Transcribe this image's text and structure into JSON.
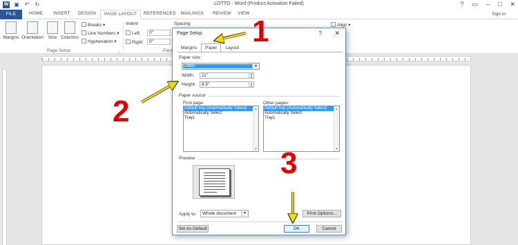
{
  "window": {
    "title": "LOTTO - Word (Product Activation Failed)",
    "quick_access": [
      "word-icon",
      "save-icon",
      "undo-icon",
      "redo-icon"
    ],
    "controls": [
      "?",
      "▭",
      "–",
      "□",
      "✕"
    ]
  },
  "ribbon": {
    "tabs": [
      {
        "label": "FILE"
      },
      {
        "label": "HOME"
      },
      {
        "label": "INSERT"
      },
      {
        "label": "DESIGN"
      },
      {
        "label": "PAGE LAYOUT"
      },
      {
        "label": "REFERENCES"
      },
      {
        "label": "MAILINGS"
      },
      {
        "label": "REVIEW"
      },
      {
        "label": "VIEW"
      }
    ],
    "active_tab": "PAGE LAYOUT",
    "sign_in": "Sign in",
    "page_setup": {
      "margins": "Margins",
      "orientation": "Orientation",
      "size": "Size",
      "columns": "Columns",
      "breaks": "Breaks",
      "line_numbers": "Line Numbers",
      "hyphenation": "Hyphenation",
      "group_label": "Page Setup"
    },
    "paragraph": {
      "indent_label": "Indent",
      "left_label": "Left:",
      "left_value": "0\"",
      "right_label": "Right:",
      "right_value": "0\"",
      "spacing_label": "Spacing",
      "group_label_partial": "Para"
    },
    "arrange": {
      "align": "Align"
    }
  },
  "dialog": {
    "title": "Page Setup",
    "help": "?",
    "close": "✕",
    "tabs": [
      "Margins",
      "Paper",
      "Layout"
    ],
    "active_tab": "Paper",
    "paper_size_label": "Paper size:",
    "paper_size_value": "Letter",
    "width_label": "Width:",
    "width_value": "11\"",
    "height_label": "Height:",
    "height_value": "8.5\"",
    "paper_source_label": "Paper source",
    "first_page_label": "First page:",
    "first_page_items": [
      "Default tray (Automatically Select)",
      "Automatically Select",
      "Tray1"
    ],
    "other_pages_label": "Other pages:",
    "other_pages_items": [
      "Default tray (Automatically Select)",
      "Automatically Select",
      "Tray1"
    ],
    "preview_label": "Preview",
    "apply_to_label": "Apply to:",
    "apply_to_value": "Whole document",
    "print_options": "Print Options...",
    "set_as_default": "Set As Default",
    "ok": "OK",
    "cancel": "Cancel"
  },
  "annotations": {
    "step1": "1",
    "step2": "2",
    "step3": "3",
    "color": "#e00000",
    "arrow_color": "#f5d800"
  }
}
